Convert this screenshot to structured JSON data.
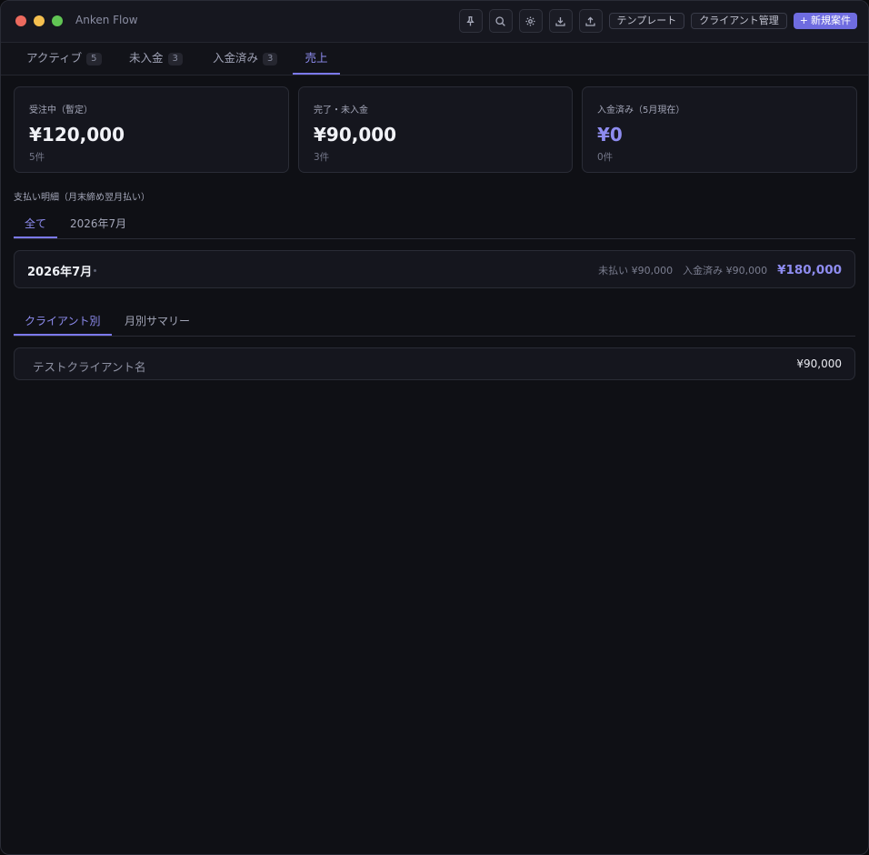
{
  "app": {
    "title": "Anken Flow"
  },
  "toolbar": {
    "template_label": "テンプレート",
    "client_mgmt_label": "クライアント管理",
    "new_label": "新規案件",
    "new_plus": "+"
  },
  "tabs": [
    {
      "label": "アクティブ",
      "count": "5"
    },
    {
      "label": "未入金",
      "count": "3"
    },
    {
      "label": "入金済み",
      "count": "3"
    },
    {
      "label": "売上"
    }
  ],
  "cards": [
    {
      "label": "受注中（暫定）",
      "value": "¥120,000",
      "sub": "5件"
    },
    {
      "label": "完了・未入金",
      "value": "¥90,000",
      "sub": "3件"
    },
    {
      "label": "入金済み（5月現在）",
      "value": "¥0",
      "sub": "0件"
    }
  ],
  "payment": {
    "title": "支払い明細（月末締め翌月払い）",
    "filters": [
      "全て",
      "2026年7月"
    ],
    "rows": [
      {
        "month": "2026年7月",
        "unpaid": "未払い ¥90,000",
        "paid": "入金済み ¥90,000",
        "total": "¥180,000"
      }
    ]
  },
  "breakdown": {
    "tabs": [
      "クライアント別",
      "月別サマリー"
    ],
    "rows": [
      {
        "client": "テストクライアント名",
        "amount": "¥90,000"
      }
    ]
  },
  "colors": {
    "accent": "#7b79ec",
    "background": "#0f1015"
  }
}
